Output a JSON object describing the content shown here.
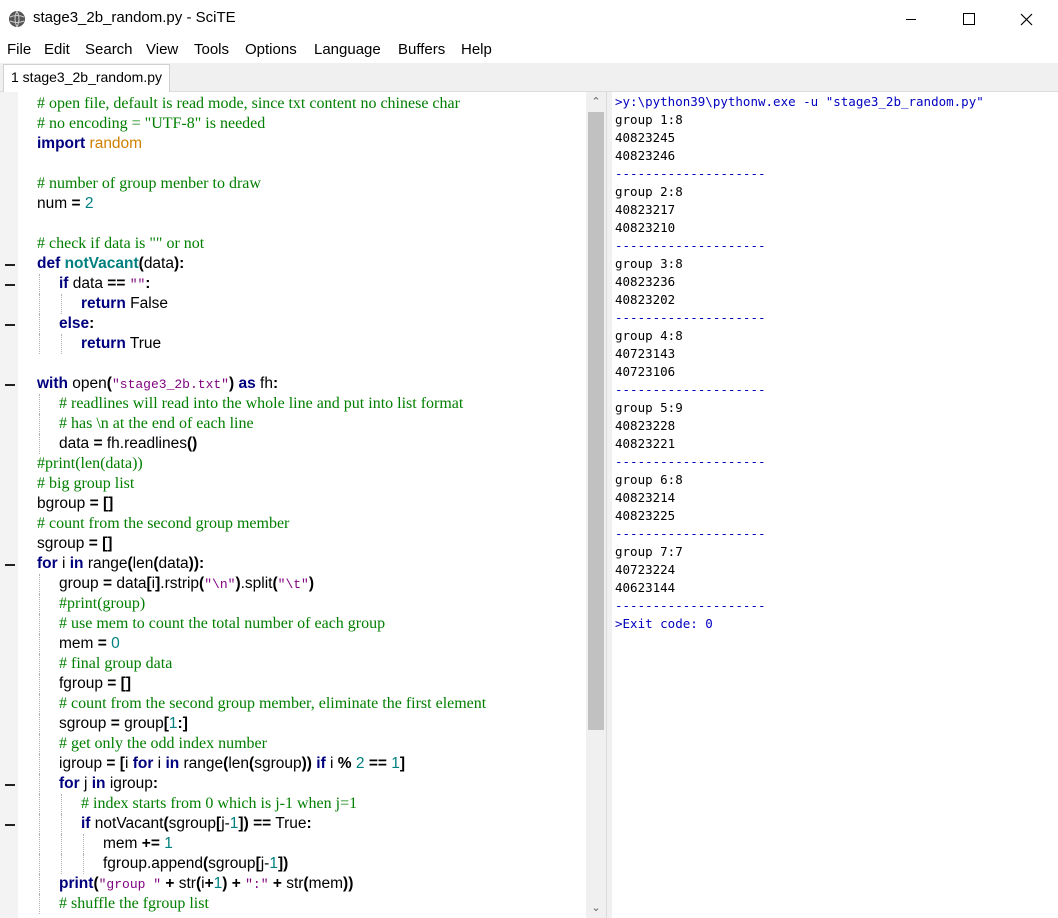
{
  "window": {
    "title": "stage3_2b_random.py - SciTE",
    "app_icon": "scite-globe-icon",
    "controls": [
      "minimize-icon",
      "maximize-icon",
      "close-icon"
    ]
  },
  "menu": [
    "File",
    "Edit",
    "Search",
    "View",
    "Tools",
    "Options",
    "Language",
    "Buffers",
    "Help"
  ],
  "tabs": [
    {
      "label": "1 stage3_2b_random.py",
      "active": true
    }
  ],
  "colors": {
    "comment": "#007f00",
    "keyword": "#00007f",
    "function_name": "#007f7f",
    "number": "#007f7f",
    "string": "#7f007f",
    "output_command": "#0000c0"
  },
  "editor": {
    "lines": [
      "# open file, default is read mode, since txt content no chinese char",
      "# no encoding = \"UTF-8\" is needed",
      "import random",
      "",
      "# number of group menber to draw",
      "num = 2",
      "",
      "# check if data is \"\" or not",
      "def notVacant(data):",
      "    if data == \"\":",
      "        return False",
      "    else:",
      "        return True",
      "",
      "with open(\"stage3_2b.txt\") as fh:",
      "    # readlines will read into the whole line and put into list format",
      "    # has \\n at the end of each line",
      "    data = fh.readlines()",
      "#print(len(data))",
      "# big group list",
      "bgroup = []",
      "# count from the second group member",
      "sgroup = []",
      "for i in range(len(data)):",
      "    group = data[i].rstrip(\"\\n\").split(\"\\t\")",
      "    #print(group)",
      "    # use mem to count the total number of each group",
      "    mem = 0",
      "    # final group data",
      "    fgroup = []",
      "    # count from the second group member, eliminate the first element",
      "    sgroup = group[1:]",
      "    # get only the odd index number",
      "    igroup = [i for i in range(len(sgroup)) if i % 2 == 1]",
      "    for j in igroup:",
      "        # index starts from 0 which is j-1 when j=1",
      "        if notVacant(sgroup[j-1]) == True:",
      "            mem += 1",
      "            fgroup.append(sgroup[j-1])",
      "    print(\"group \" + str(i+1) + \":\" + str(mem))",
      "    # shuffle the fgroup list"
    ]
  },
  "output": {
    "lines": [
      ">y:\\python39\\pythonw.exe -u \"stage3_2b_random.py\"",
      "group 1:8",
      "40823245",
      "40823246",
      "--------------------",
      "group 2:8",
      "40823217",
      "40823210",
      "--------------------",
      "group 3:8",
      "40823236",
      "40823202",
      "--------------------",
      "group 4:8",
      "40723143",
      "40723106",
      "--------------------",
      "group 5:9",
      "40823228",
      "40823221",
      "--------------------",
      "group 6:8",
      "40823214",
      "40823225",
      "--------------------",
      "group 7:7",
      "40723224",
      "40623144",
      "--------------------",
      ">Exit code: 0"
    ]
  }
}
